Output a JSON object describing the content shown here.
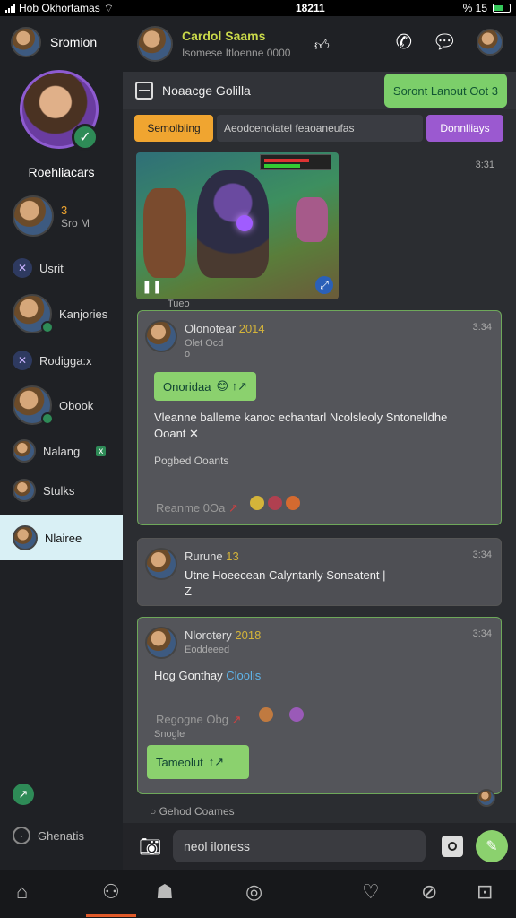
{
  "status": {
    "carrier": "Hob Okhortamas",
    "time": "18211",
    "battery": "% 15"
  },
  "sidebar": {
    "user_name": "Sromion",
    "profile_title": "Roehliacars",
    "items": [
      {
        "label": "Sro M",
        "badge": "3"
      },
      {
        "label": "Usrit"
      },
      {
        "label": "Kanjories"
      },
      {
        "label": "Rodigga:x"
      },
      {
        "label": "Obook"
      },
      {
        "label": "Nalang",
        "badge": "x"
      },
      {
        "label": "Stulks"
      },
      {
        "label": "Nlairee"
      }
    ],
    "bottom_label": "Ghenatis"
  },
  "header": {
    "title": "Cardol Saams",
    "subtitle": "Isomese Itloenne 0000"
  },
  "toolbar": {
    "label": "Noaacge Golilla",
    "action_button": "Soront Lanout Oot 3"
  },
  "filters": {
    "tab_left": "Semolbling",
    "search_text": "Aeodcenoiatel feaoaneufas",
    "tab_right": "Donnlliays"
  },
  "messages": {
    "image_time": "3:31",
    "image_caption": "Tueo",
    "post1": {
      "author": "Olonotear",
      "author_tag": "2014",
      "subtitle": "Olet Ocd",
      "sub2": "o",
      "time": "3:34",
      "tag": "Onoridaa",
      "body": "Vleanne balleme kanoc echantarl Ncolsleoly Sntonelldhe Ooant",
      "meta": "Pogbed Ooants",
      "footer": "Reanme 0Oa"
    },
    "post2": {
      "author": "Rurune",
      "author_tag": "13",
      "time": "3:34",
      "body": "Utne Hoeecean Calyntanly Soneatent | Z"
    },
    "post3": {
      "author": "Nlorotery",
      "author_tag": "2018",
      "subtitle": "Eoddeeed",
      "time": "3:34",
      "body_a": "Hog Gonthay",
      "body_b": "Cloolis",
      "footer": "Regogne Obg",
      "meta": "Snogle",
      "tag": "Tameolut"
    },
    "footer_line": "Gehod Coames"
  },
  "input": {
    "placeholder": "neol iloness"
  }
}
